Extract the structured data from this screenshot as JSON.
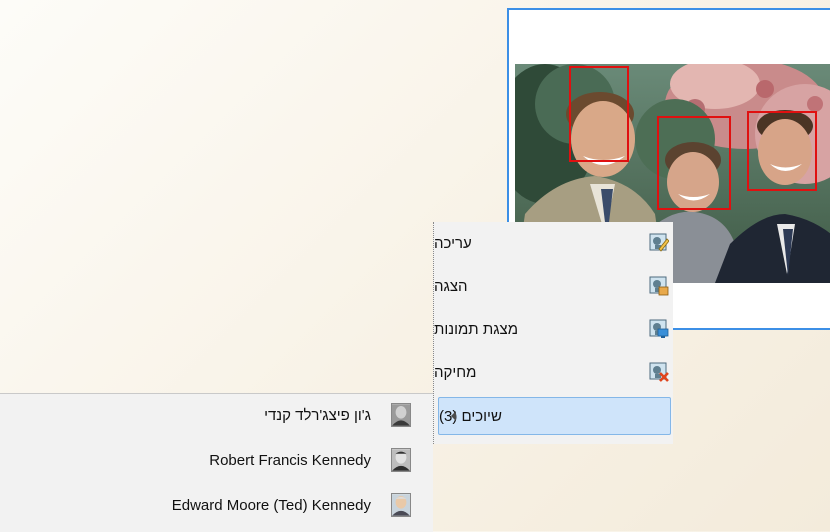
{
  "context_menu": {
    "items": [
      {
        "label": "עריכה",
        "icon": "photo-edit-icon"
      },
      {
        "label": "הצגה",
        "icon": "photo-view-icon"
      },
      {
        "label": "מצגת תמונות",
        "icon": "slideshow-icon"
      },
      {
        "label": "מחיקה",
        "icon": "photo-delete-icon"
      }
    ],
    "submenu": {
      "label": "שיוכים (3)",
      "arrow": "chevron-left-icon"
    }
  },
  "associations": [
    {
      "name": "ג'ון פיצג'רלד קנדי",
      "icon": "person-portrait-icon"
    },
    {
      "name": "Robert Francis Kennedy",
      "icon": "person-portrait-icon"
    },
    {
      "name": "Edward Moore (Ted) Kennedy",
      "icon": "person-portrait-icon"
    }
  ],
  "colors": {
    "selection_border": "#3c8fe6",
    "face_box": "#e01010",
    "submenu_highlight": "#cfe4fa",
    "menu_background": "#f2f2f2"
  }
}
